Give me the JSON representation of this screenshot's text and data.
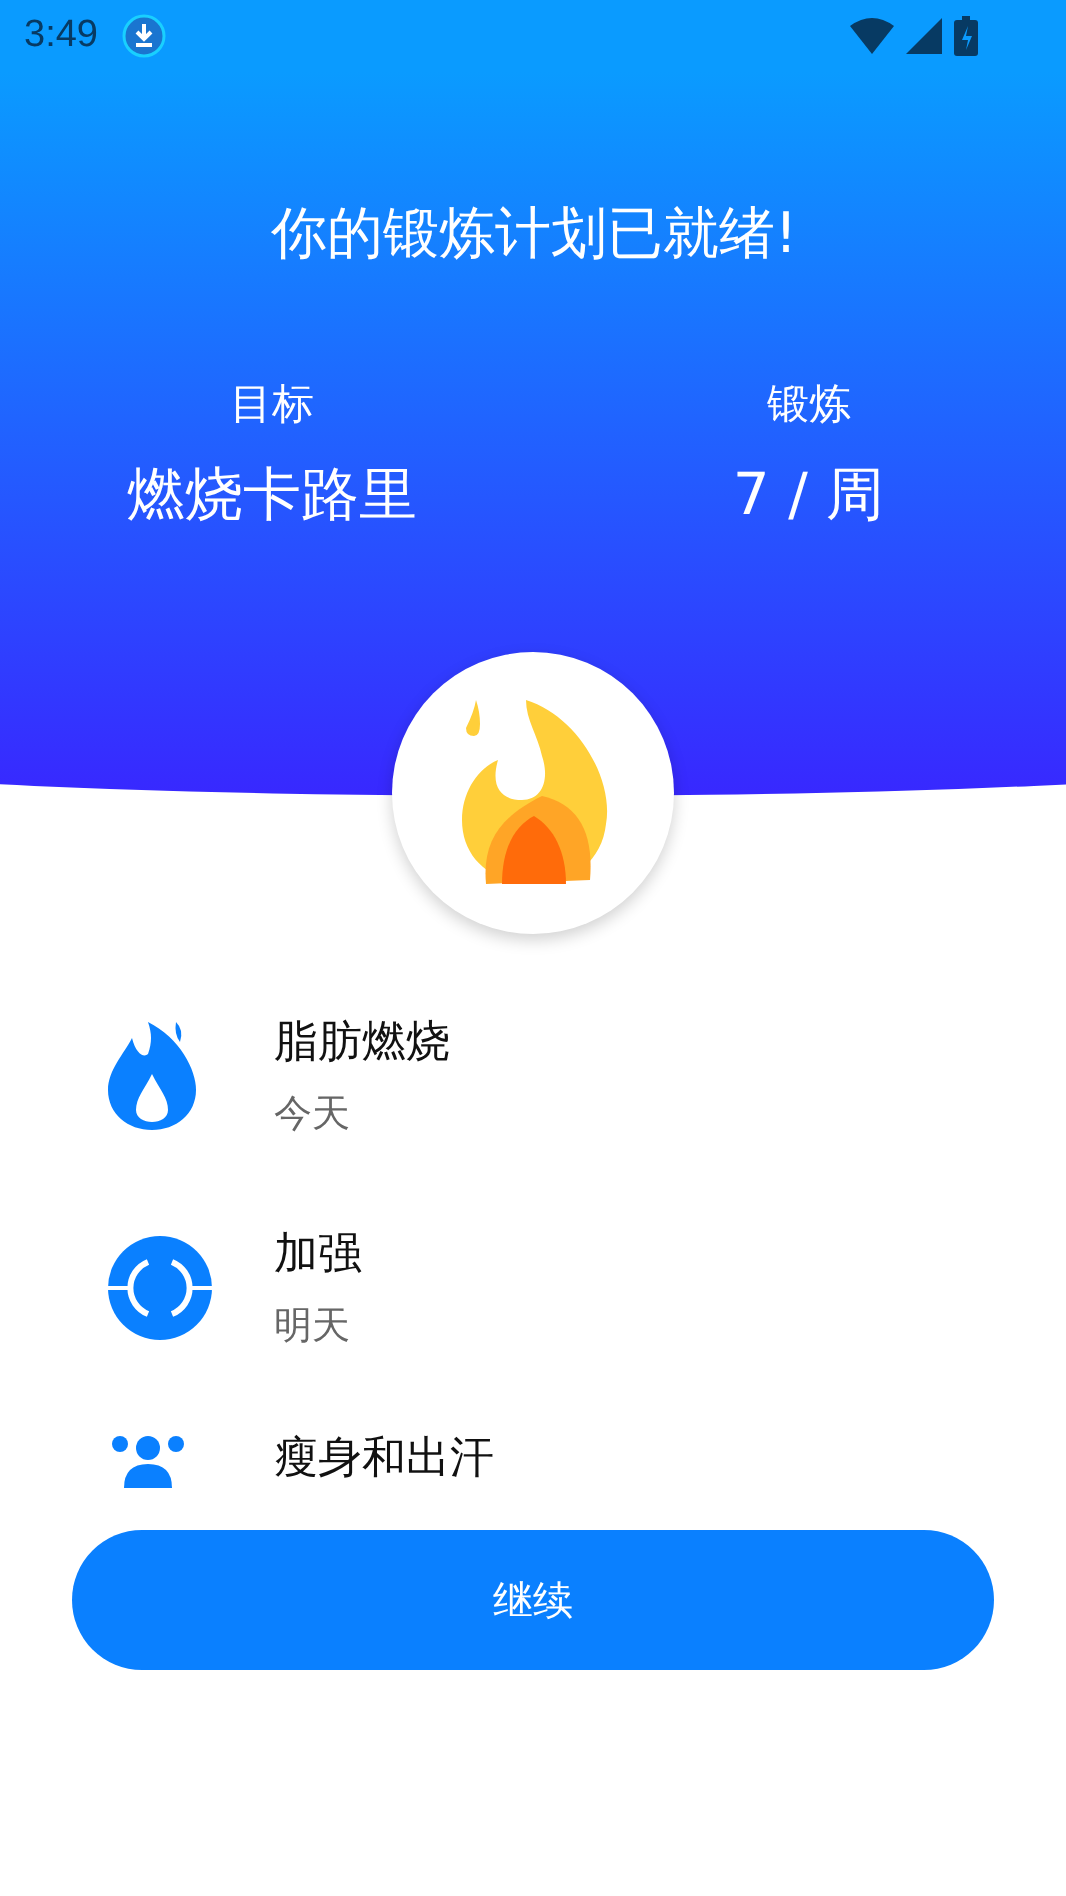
{
  "status_bar": {
    "time": "3:49"
  },
  "header": {
    "title": "你的锻炼计划已就绪!",
    "stats": [
      {
        "label": "目标",
        "value": "燃烧卡路里"
      },
      {
        "label": "锻炼",
        "value": "7 / 周"
      }
    ]
  },
  "plan": [
    {
      "kind": "flame",
      "title": "脂肪燃烧",
      "day": "今天"
    },
    {
      "kind": "ring",
      "title": "加强",
      "day": "明天"
    },
    {
      "kind": "people",
      "title": "瘦身和出汗"
    }
  ],
  "continue_button": "继续"
}
